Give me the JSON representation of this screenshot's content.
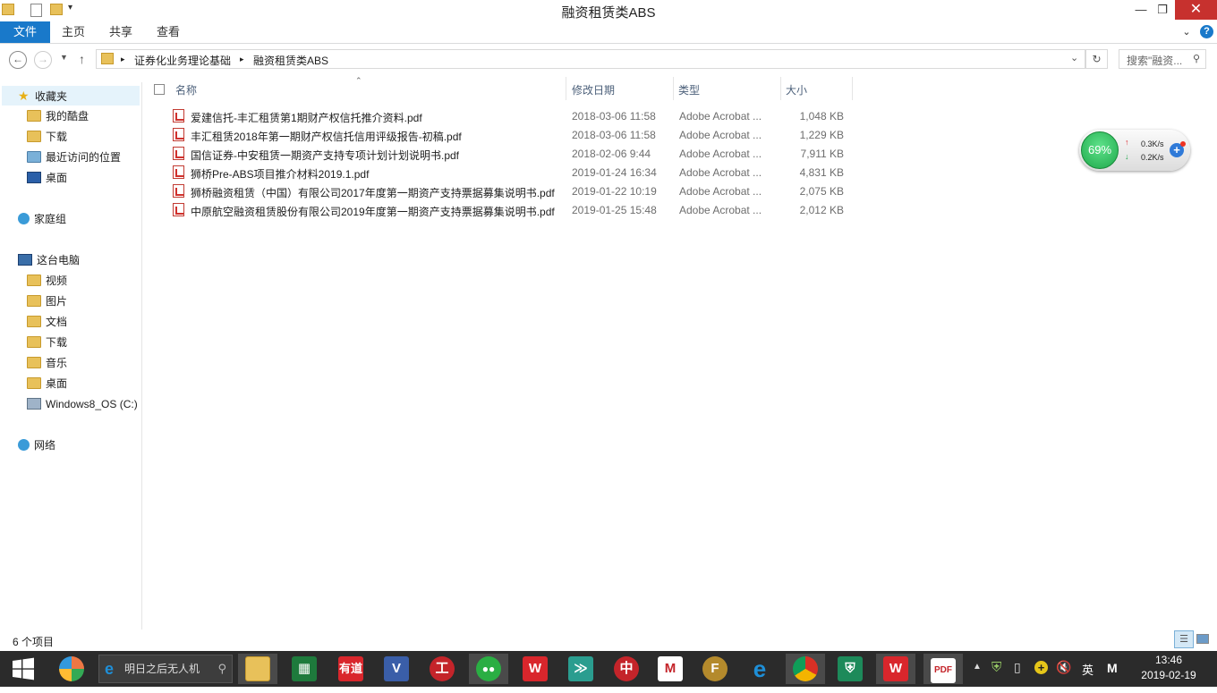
{
  "window": {
    "title": "融资租赁类ABS"
  },
  "ribbon": {
    "tabs": [
      "文件",
      "主页",
      "共享",
      "查看"
    ]
  },
  "address": {
    "breadcrumb": [
      "证券化业务理论基础",
      "融资租赁类ABS"
    ],
    "search_placeholder": "搜索\"融资..."
  },
  "nav": {
    "favorites": {
      "label": "收藏夹",
      "items": [
        "我的酷盘",
        "下载",
        "最近访问的位置",
        "桌面"
      ]
    },
    "homegroup": "家庭组",
    "thispc": {
      "label": "这台电脑",
      "items": [
        "视频",
        "图片",
        "文档",
        "下载",
        "音乐",
        "桌面",
        "Windows8_OS (C:)"
      ]
    },
    "network": "网络"
  },
  "columns": {
    "name": "名称",
    "date": "修改日期",
    "type": "类型",
    "size": "大小"
  },
  "files": [
    {
      "name": "爱建信托-丰汇租赁第1期财产权信托推介资料.pdf",
      "date": "2018-03-06 11:58",
      "type": "Adobe Acrobat ...",
      "size": "1,048 KB"
    },
    {
      "name": "丰汇租赁2018年第一期财产权信托信用评级报告-初稿.pdf",
      "date": "2018-03-06 11:58",
      "type": "Adobe Acrobat ...",
      "size": "1,229 KB"
    },
    {
      "name": "国信证券-中安租赁一期资产支持专项计划计划说明书.pdf",
      "date": "2018-02-06 9:44",
      "type": "Adobe Acrobat ...",
      "size": "7,911 KB"
    },
    {
      "name": "狮桥Pre-ABS项目推介材料2019.1.pdf",
      "date": "2019-01-24 16:34",
      "type": "Adobe Acrobat ...",
      "size": "4,831 KB"
    },
    {
      "name": "狮桥融资租赁（中国）有限公司2017年度第一期资产支持票据募集说明书.pdf",
      "date": "2019-01-22 10:19",
      "type": "Adobe Acrobat ...",
      "size": "2,075 KB"
    },
    {
      "name": "中原航空融资租赁股份有限公司2019年度第一期资产支持票据募集说明书.pdf",
      "date": "2019-01-25 15:48",
      "type": "Adobe Acrobat ...",
      "size": "2,012 KB"
    }
  ],
  "status": {
    "count": "6 个项目"
  },
  "widget": {
    "percent": "69%",
    "up": "0.3K/s",
    "down": "0.2K/s"
  },
  "taskbar": {
    "search_text": "明日之后无人机",
    "apps": [
      {
        "icon": "file-explorer-icon",
        "glyph": "",
        "color": "#e8c15a"
      },
      {
        "icon": "excel-icon",
        "glyph": "▦",
        "color": "#1e7a3c"
      },
      {
        "icon": "youdao-icon",
        "glyph": "有道",
        "color": "#d9262c"
      },
      {
        "icon": "visio-icon",
        "glyph": "V",
        "color": "#3a5ea8"
      },
      {
        "icon": "icbc-icon",
        "glyph": "工",
        "color": "#c4242a"
      },
      {
        "icon": "wechat-icon",
        "glyph": "●",
        "color": "#2aae43"
      },
      {
        "icon": "wps-icon",
        "glyph": "W",
        "color": "#d9262c"
      },
      {
        "icon": "arrow-app-icon",
        "glyph": "≫",
        "color": "#2a9d8f"
      },
      {
        "icon": "citic-icon",
        "glyph": "中",
        "color": "#c4242a"
      },
      {
        "icon": "cmb-icon",
        "glyph": "M",
        "color": "#c4242a"
      },
      {
        "icon": "f-app-icon",
        "glyph": "F",
        "color": "#b48a2c"
      },
      {
        "icon": "ie-icon",
        "glyph": "e",
        "color": "#1e8fd8"
      },
      {
        "icon": "chrome-icon",
        "glyph": "◉",
        "color": "#2e8b3a"
      },
      {
        "icon": "security-shield-icon",
        "glyph": "⛨",
        "color": "#1d8a5a"
      },
      {
        "icon": "wps-writer-icon",
        "glyph": "W",
        "color": "#d9262c"
      },
      {
        "icon": "acrobat-icon",
        "glyph": "PDF",
        "color": "#c4242a"
      }
    ],
    "ime": "英",
    "ime2": "M",
    "time": "13:46",
    "date": "2019-02-19"
  }
}
